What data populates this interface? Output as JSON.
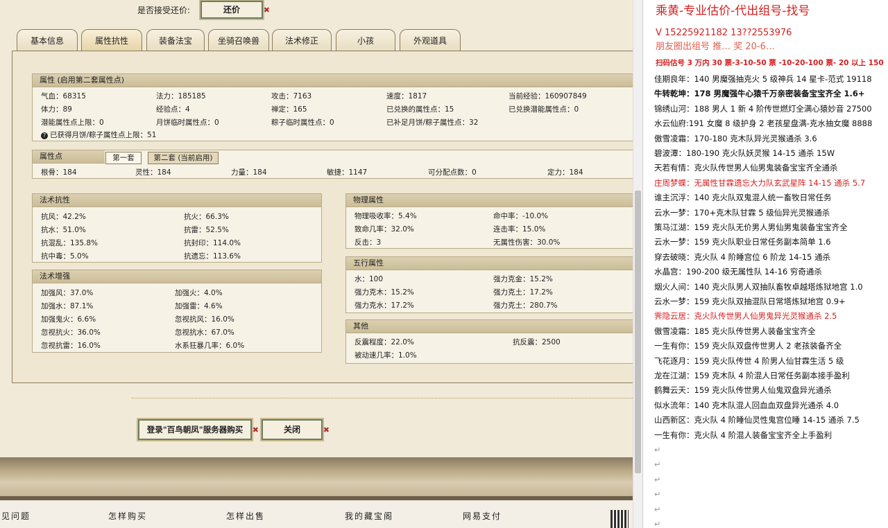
{
  "top_bar": {
    "bargain_label": "是否接受还价:",
    "bargain_button": "还价"
  },
  "tabs": [
    "基本信息",
    "属性抗性",
    "装备法宝",
    "坐骑召唤兽",
    "法术修正",
    "小孩",
    "外观道具"
  ],
  "attr_panel": {
    "title": "属性 (启用第二套属性点)",
    "rows": [
      [
        "气血：68315",
        "法力：185185",
        "攻击：7163",
        "速度：1817",
        "当前经验：160907849"
      ],
      [
        "体力：89",
        "经验点：4",
        "禅定：165",
        "已兑换的属性点：15",
        "已兑换潜能属性点：0"
      ],
      [
        "潜能属性点上限：0",
        "月饼临时属性点：0",
        "粽子临时属性点：0",
        "已补足月饼/粽子属性点：32",
        ""
      ]
    ],
    "footer": "已获得月饼/粽子属性点上限：51"
  },
  "points_panel": {
    "title": "属性点",
    "tab1": "第一套",
    "tab2": "第二套 (当前启用)",
    "values": [
      "根骨：184",
      "灵性：184",
      "力量：184",
      "敏捷：1147",
      "可分配点数：0",
      "定力：184"
    ]
  },
  "resist_panel": {
    "title": "法术抗性",
    "rows": [
      [
        "抗风：42.2%",
        "抗火：66.3%"
      ],
      [
        "抗水：51.0%",
        "抗雷：52.5%"
      ],
      [
        "抗混乱：135.8%",
        "抗封印：114.0%"
      ],
      [
        "抗中毒：5.0%",
        "抗遗忘：113.6%"
      ]
    ]
  },
  "enhance_panel": {
    "title": "法术增强",
    "rows": [
      [
        "加强风：37.0%",
        "加强火：4.0%"
      ],
      [
        "加强水：87.1%",
        "加强雷：4.6%"
      ],
      [
        "加强鬼火：6.6%",
        "忽视抗风：16.0%"
      ],
      [
        "忽视抗火：36.0%",
        "忽视抗水：67.0%"
      ],
      [
        "忽视抗雷：16.0%",
        "水系狂暴几率：6.0%"
      ]
    ]
  },
  "physical_panel": {
    "title": "物理属性",
    "rows": [
      [
        "物理吸收率：5.4%",
        "命中率：-10.0%"
      ],
      [
        "致命几率：32.0%",
        "连击率：15.0%"
      ],
      [
        "反击：3",
        "无属性伤害：30.0%"
      ]
    ]
  },
  "five_panel": {
    "title": "五行属性",
    "rows": [
      [
        "水：100",
        "强力克金：15.2%"
      ],
      [
        "强力克木：15.2%",
        "强力克土：17.2%"
      ],
      [
        "强力克水：17.2%",
        "强力克土：280.7%"
      ]
    ]
  },
  "other_panel": {
    "title": "其他",
    "rows": [
      [
        "反震程度：22.0%",
        "抗反震：2500"
      ],
      [
        "被动速几率：1.0%",
        ""
      ]
    ]
  },
  "actions": {
    "buy_button": "登录\"百鸟朝凤\"服务器购买",
    "close_button": "关闭"
  },
  "footer_nav": [
    "见问题",
    "怎样购买",
    "怎样出售",
    "我的藏宝阁",
    "网易支付"
  ],
  "right_doc": {
    "title": "乘黄-专业估价-代出组号-找号",
    "phone": "V   15225921182   13??2553976",
    "promo": "朋友圈出组号  推…  奖 20-6…",
    "price_line": "扫码估号 3 万内 30 票-3-10-50 票  -10-20-100 票- 20 以上 150",
    "lines": [
      {
        "text": "佳期良年：140 男魔强抽克火 5 级神兵 14 星卡-范式 19118",
        "color": "#111",
        "bold": false
      },
      {
        "text": "牛转乾坤：178 男魔强牛心猿千万亲密装备宝宝齐全 1.6+",
        "color": "#111",
        "bold": true
      },
      {
        "text": "锦绣山河：188 男人 1 新 4 阶传世燃灯全满心猿妙音 27500",
        "color": "#111",
        "bold": false
      },
      {
        "text": "水云仙府:191 女魔 8 级护身 2 老孩星盘满-克水抽女魔 8888",
        "color": "#111",
        "bold": false
      },
      {
        "text": "傲雪凌霜：170-180 克木队异光灵猴通杀 3.6",
        "color": "#111",
        "bold": false
      },
      {
        "text": "碧波潭：180-190 克火队妖灵猴 14-15 通杀 15W",
        "color": "#111",
        "bold": false
      },
      {
        "text": "天若有情：克火队传世男人仙男鬼装备宝宝齐全通杀",
        "color": "#111",
        "bold": false
      },
      {
        "text": "庄周梦蝶：无属性甘霖遗忘大力队玄武星阵 14-15 通杀 5.7",
        "color": "#d42020",
        "bold": false
      },
      {
        "text": "谁主沉浮：140 克火队双鬼混人统一畜牧日常任务",
        "color": "#111",
        "bold": false
      },
      {
        "text": "云水一梦：170+克木队甘霖 5 级仙异光灵猴通杀",
        "color": "#111",
        "bold": false
      },
      {
        "text": "策马江湖：159 克火队无价男人男仙男鬼装备宝宝齐全",
        "color": "#111",
        "bold": false
      },
      {
        "text": "云水一梦：159 克火队职业日常任务副本简单 1.6",
        "color": "#111",
        "bold": false
      },
      {
        "text": "穿去破晓：克火队 4 阶睡宫位 6 阶龙 14-15 通杀",
        "color": "#111",
        "bold": false
      },
      {
        "text": "水晶宫：190-200 级无属性队 14-16 穷奇通杀",
        "color": "#111",
        "bold": false
      },
      {
        "text": "烟火人间：140 克火队男人双抽队畜牧卓越塔炼狱地宫 1.0",
        "color": "#111",
        "bold": false
      },
      {
        "text": "云水一梦：159 克火队双抽混队日常塔炼狱地宫 0.9+",
        "color": "#111",
        "bold": false
      },
      {
        "text": "霁隐云居：克火队传世男人仙男鬼异光灵猴通杀 2.5",
        "color": "#d42020",
        "bold": false
      },
      {
        "text": "傲雪凌霜：185 克火队传世男人装备宝宝齐全",
        "color": "#111",
        "bold": false
      },
      {
        "text": "一生有你：159 克火队双盘传世男人 2 老孩装备齐全",
        "color": "#111",
        "bold": false
      },
      {
        "text": "飞花逐月：159 克火队传世 4 阶男人仙甘霖生活 5 级",
        "color": "#111",
        "bold": false
      },
      {
        "text": "龙在江湖：159 克木队 4 阶混人日常任务副本接手盈利",
        "color": "#111",
        "bold": false
      },
      {
        "text": "鹤舞云天：159 克火队传世男人仙鬼双盘异光通杀",
        "color": "#111",
        "bold": false
      },
      {
        "text": "似水流年：140 克木队混人回血血双盘异光通杀 4.0",
        "color": "#111",
        "bold": false
      },
      {
        "text": "山西新区：克火队 4 阶睡仙灵性鬼宫位睡 14-15 通杀 7.5",
        "color": "#111",
        "bold": false
      },
      {
        "text": "一生有你：克火队 4 阶混人装备宝宝齐全上手盈利",
        "color": "#111",
        "bold": false
      }
    ]
  },
  "colors": {
    "red_title": "#d42020",
    "panel_header": "#cbbd97",
    "button_border": "#6b7d61"
  }
}
